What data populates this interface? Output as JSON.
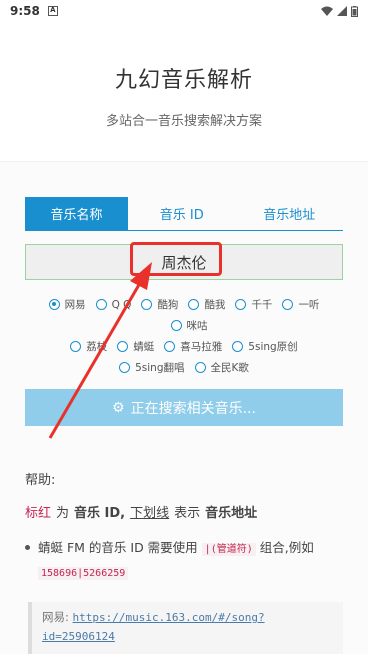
{
  "status_bar": {
    "time": "9:58",
    "a_icon": "A"
  },
  "header": {
    "title": "九幻音乐解析",
    "subtitle": "多站合一音乐搜索解决方案"
  },
  "tabs": [
    {
      "label": "音乐名称",
      "active": true
    },
    {
      "label": "音乐 ID",
      "active": false
    },
    {
      "label": "音乐地址",
      "active": false
    }
  ],
  "search": {
    "value": "周杰伦"
  },
  "sources": {
    "row1": [
      {
        "label": "网易",
        "selected": true
      },
      {
        "label": "Q Q",
        "selected": false
      },
      {
        "label": "酷狗",
        "selected": false
      },
      {
        "label": "酷我",
        "selected": false
      },
      {
        "label": "千千",
        "selected": false
      },
      {
        "label": "一听",
        "selected": false
      }
    ],
    "row2": [
      {
        "label": "咪咕",
        "selected": false
      }
    ],
    "row3": [
      {
        "label": "荔枝",
        "selected": false
      },
      {
        "label": "蜻蜓",
        "selected": false
      },
      {
        "label": "喜马拉雅",
        "selected": false
      },
      {
        "label": "5sing原创",
        "selected": false
      }
    ],
    "row4": [
      {
        "label": "5sing翻唱",
        "selected": false
      },
      {
        "label": "全民K歌",
        "selected": false
      }
    ]
  },
  "submit_label": "正在搜索相关音乐...",
  "help": {
    "title": "帮助:",
    "legend": {
      "red_word": "标红",
      "wei": "为",
      "music_id": "音乐 ID,",
      "underline_word": "下划线",
      "biaoshi": "表示",
      "music_url": "音乐地址"
    },
    "bullet": {
      "text1": "蜻蜓 FM 的音乐 ID 需要使用",
      "code1": "|(管道符)",
      "text2": "组合,例如",
      "code2": "158696|5266259"
    },
    "quote": {
      "label": "网易:",
      "url_line1": "https://music.163.com/#/song?",
      "url_line2": "id=25906124"
    }
  },
  "colors": {
    "accent": "#1a8fcf",
    "button_disabled": "#8fcdea",
    "highlight": "#e8312a"
  }
}
